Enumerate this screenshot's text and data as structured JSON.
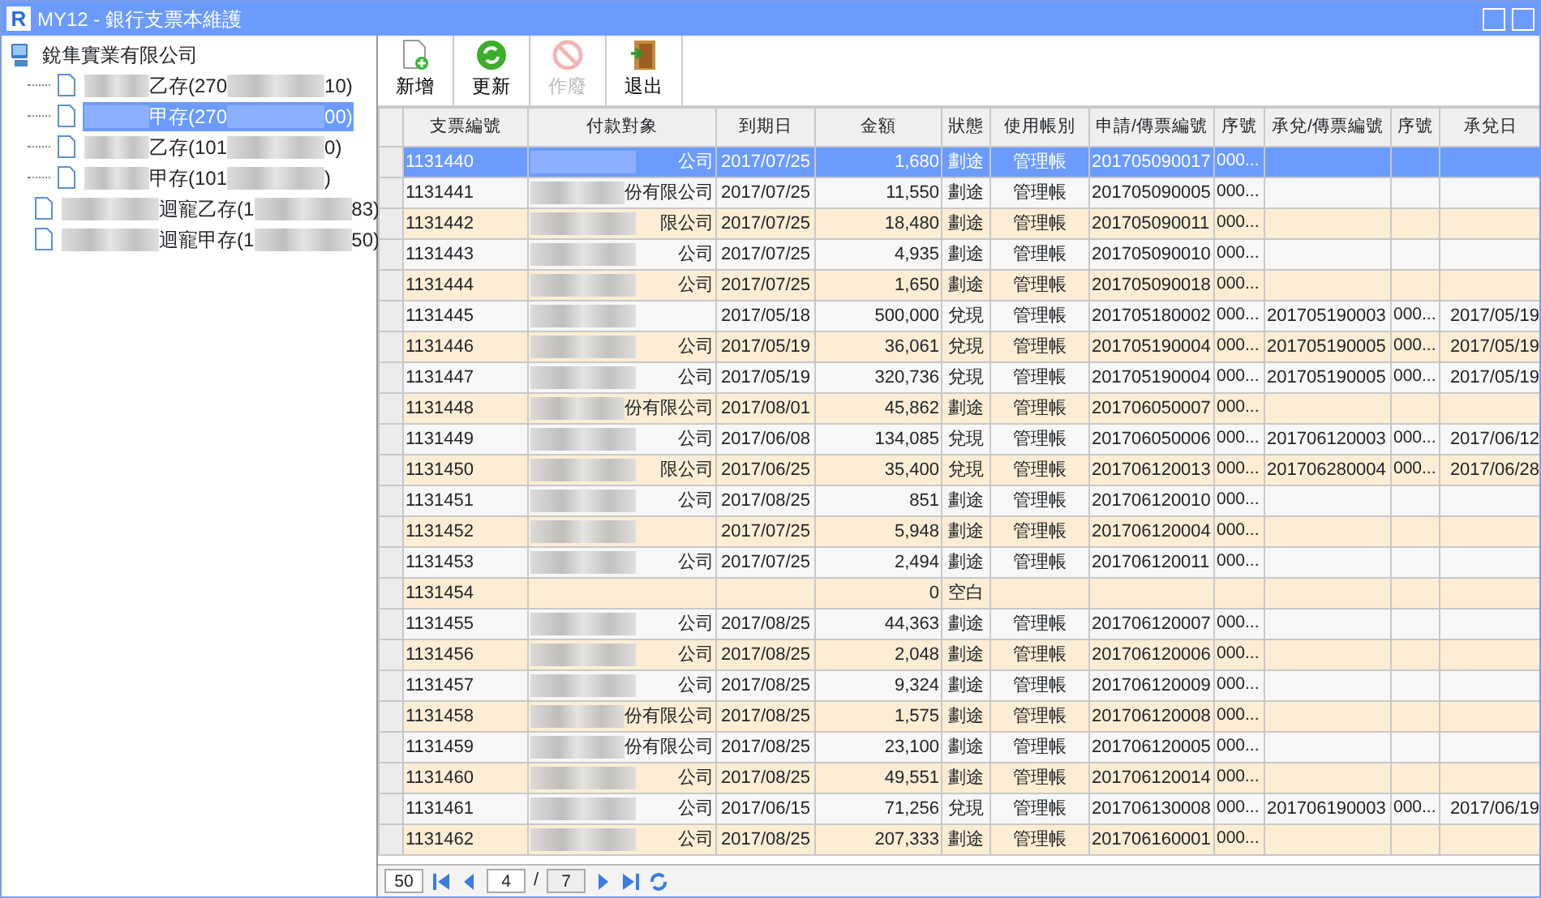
{
  "window": {
    "logo": "R",
    "title": "MY12 - 銀行支票本維護"
  },
  "tree": {
    "root": "銳隼實業有限公司",
    "children": [
      {
        "label_start": "乙存(270",
        "label_end": "10)",
        "selected": false
      },
      {
        "label_start": "甲存(270",
        "label_end": "00)",
        "selected": true
      },
      {
        "label_start": "乙存(101",
        "label_end": "0)",
        "selected": false
      },
      {
        "label_start": "甲存(101",
        "label_end": ")",
        "selected": false
      },
      {
        "label_start": "迴寵乙存(1",
        "label_end": "83)",
        "selected": false
      },
      {
        "label_start": "迴寵甲存(1",
        "label_end": "50)",
        "selected": false
      }
    ]
  },
  "toolbar": [
    {
      "label": "新增",
      "kind": "add",
      "disabled": false
    },
    {
      "label": "更新",
      "kind": "refresh",
      "disabled": false
    },
    {
      "label": "作廢",
      "kind": "void",
      "disabled": true
    },
    {
      "label": "退出",
      "kind": "exit",
      "disabled": false
    }
  ],
  "table": {
    "columns": [
      "支票編號",
      "付款對象",
      "到期日",
      "金額",
      "狀態",
      "使用帳別",
      "申請/傳票編號",
      "序號",
      "承兌/傳票編號",
      "序號",
      "承兌日"
    ],
    "rows": [
      {
        "selected": true,
        "blurred": true,
        "cells": [
          "1131440",
          "公司",
          "2017/07/25",
          "1,680",
          "劃途",
          "管理帳",
          "201705090017",
          "000...",
          "",
          "",
          ""
        ]
      },
      {
        "selected": false,
        "blurred": true,
        "cells": [
          "1131441",
          "份有限公司",
          "2017/07/25",
          "11,550",
          "劃途",
          "管理帳",
          "201705090005",
          "000...",
          "",
          "",
          ""
        ]
      },
      {
        "selected": false,
        "blurred": true,
        "cells": [
          "1131442",
          "限公司",
          "2017/07/25",
          "18,480",
          "劃途",
          "管理帳",
          "201705090011",
          "000...",
          "",
          "",
          ""
        ]
      },
      {
        "selected": false,
        "blurred": true,
        "cells": [
          "1131443",
          "公司",
          "2017/07/25",
          "4,935",
          "劃途",
          "管理帳",
          "201705090010",
          "000...",
          "",
          "",
          ""
        ]
      },
      {
        "selected": false,
        "blurred": true,
        "cells": [
          "1131444",
          "公司",
          "2017/07/25",
          "1,650",
          "劃途",
          "管理帳",
          "201705090018",
          "000...",
          "",
          "",
          ""
        ]
      },
      {
        "selected": false,
        "blurred": true,
        "cells": [
          "1131445",
          "",
          "2017/05/18",
          "500,000",
          "兌現",
          "管理帳",
          "201705180002",
          "000...",
          "201705190003",
          "000...",
          "2017/05/19"
        ]
      },
      {
        "selected": false,
        "blurred": true,
        "cells": [
          "1131446",
          "公司",
          "2017/05/19",
          "36,061",
          "兌現",
          "管理帳",
          "201705190004",
          "000...",
          "201705190005",
          "000...",
          "2017/05/19"
        ]
      },
      {
        "selected": false,
        "blurred": true,
        "cells": [
          "1131447",
          "公司",
          "2017/05/19",
          "320,736",
          "兌現",
          "管理帳",
          "201705190004",
          "000...",
          "201705190005",
          "000...",
          "2017/05/19"
        ]
      },
      {
        "selected": false,
        "blurred": true,
        "cells": [
          "1131448",
          "份有限公司",
          "2017/08/01",
          "45,862",
          "劃途",
          "管理帳",
          "201706050007",
          "000...",
          "",
          "",
          ""
        ]
      },
      {
        "selected": false,
        "blurred": true,
        "cells": [
          "1131449",
          "公司",
          "2017/06/08",
          "134,085",
          "兌現",
          "管理帳",
          "201706050006",
          "000...",
          "201706120003",
          "000...",
          "2017/06/12"
        ]
      },
      {
        "selected": false,
        "blurred": true,
        "cells": [
          "1131450",
          "限公司",
          "2017/06/25",
          "35,400",
          "兌現",
          "管理帳",
          "201706120013",
          "000...",
          "201706280004",
          "000...",
          "2017/06/28"
        ]
      },
      {
        "selected": false,
        "blurred": true,
        "cells": [
          "1131451",
          "公司",
          "2017/08/25",
          "851",
          "劃途",
          "管理帳",
          "201706120010",
          "000...",
          "",
          "",
          ""
        ]
      },
      {
        "selected": false,
        "blurred": true,
        "cells": [
          "1131452",
          "",
          "2017/07/25",
          "5,948",
          "劃途",
          "管理帳",
          "201706120004",
          "000...",
          "",
          "",
          ""
        ]
      },
      {
        "selected": false,
        "blurred": true,
        "cells": [
          "1131453",
          "公司",
          "2017/07/25",
          "2,494",
          "劃途",
          "管理帳",
          "201706120011",
          "000...",
          "",
          "",
          ""
        ]
      },
      {
        "selected": false,
        "blurred": false,
        "cells": [
          "1131454",
          "",
          "",
          "0",
          "空白",
          "",
          "",
          "",
          "",
          "",
          ""
        ]
      },
      {
        "selected": false,
        "blurred": true,
        "cells": [
          "1131455",
          "公司",
          "2017/08/25",
          "44,363",
          "劃途",
          "管理帳",
          "201706120007",
          "000...",
          "",
          "",
          ""
        ]
      },
      {
        "selected": false,
        "blurred": true,
        "cells": [
          "1131456",
          "公司",
          "2017/08/25",
          "2,048",
          "劃途",
          "管理帳",
          "201706120006",
          "000...",
          "",
          "",
          ""
        ]
      },
      {
        "selected": false,
        "blurred": true,
        "cells": [
          "1131457",
          "公司",
          "2017/08/25",
          "9,324",
          "劃途",
          "管理帳",
          "201706120009",
          "000...",
          "",
          "",
          ""
        ]
      },
      {
        "selected": false,
        "blurred": true,
        "cells": [
          "1131458",
          "份有限公司",
          "2017/08/25",
          "1,575",
          "劃途",
          "管理帳",
          "201706120008",
          "000...",
          "",
          "",
          ""
        ]
      },
      {
        "selected": false,
        "blurred": true,
        "cells": [
          "1131459",
          "份有限公司",
          "2017/08/25",
          "23,100",
          "劃途",
          "管理帳",
          "201706120005",
          "000...",
          "",
          "",
          ""
        ]
      },
      {
        "selected": false,
        "blurred": true,
        "cells": [
          "1131460",
          "公司",
          "2017/08/25",
          "49,551",
          "劃途",
          "管理帳",
          "201706120014",
          "000...",
          "",
          "",
          ""
        ]
      },
      {
        "selected": false,
        "blurred": true,
        "cells": [
          "1131461",
          "公司",
          "2017/06/15",
          "71,256",
          "兌現",
          "管理帳",
          "201706130008",
          "000...",
          "201706190003",
          "000...",
          "2017/06/19"
        ]
      },
      {
        "selected": false,
        "blurred": true,
        "cells": [
          "1131462",
          "公司",
          "2017/08/25",
          "207,333",
          "劃途",
          "管理帳",
          "201706160001",
          "000...",
          "",
          "",
          ""
        ]
      }
    ]
  },
  "pager": {
    "page_size": "50",
    "page": "4",
    "separator": "/",
    "total": "7"
  }
}
